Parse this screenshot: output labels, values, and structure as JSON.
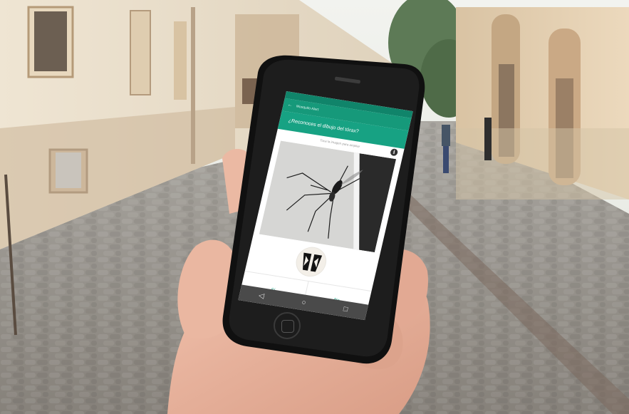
{
  "app": {
    "toolbar_title": "Mosquito Alert",
    "question": "¿Reconoces el dibujo del tórax?",
    "hint": "Toca la imagen para ampliar",
    "info_icon": "info-icon",
    "buttons": [
      {
        "label": "Sí"
      },
      {
        "label": "No"
      }
    ],
    "nav_icons": [
      "back-icon",
      "home-icon",
      "recents-icon"
    ]
  },
  "colors": {
    "primary": "#17a283",
    "primary_dark": "#10846a",
    "nav_bar": "#4a4a4a"
  }
}
